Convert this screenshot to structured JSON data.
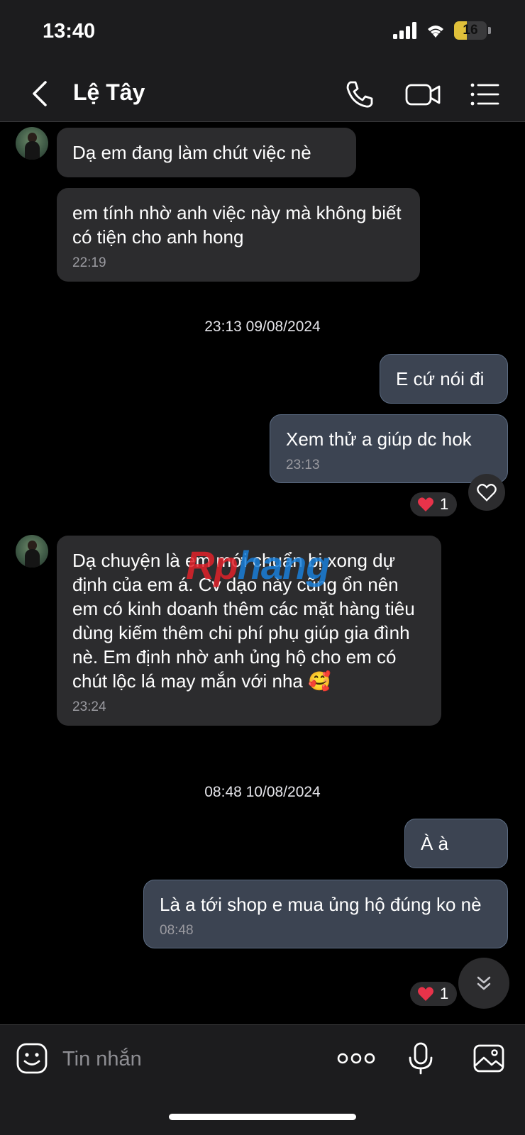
{
  "status_bar": {
    "time": "13:40",
    "battery": "16"
  },
  "header": {
    "contact_name": "Lệ Tây"
  },
  "messages": [
    {
      "text": "Dạ em đang làm chút việc nè"
    },
    {
      "text": "em tính nhờ anh việc này mà không biết có tiện cho anh hong",
      "time": "22:19"
    },
    {
      "text": "E cứ nói đi"
    },
    {
      "text": "Xem thử a giúp dc hok",
      "time": "23:13"
    },
    {
      "text": "Dạ chuyện là em mới chuẩn bị xong dự định của em á. Cv dạo này cũng ổn nên em có kinh doanh thêm các mặt hàng tiêu dùng kiếm thêm chi phí phụ giúp gia đình nè. Em định nhờ anh ủng hộ cho em có chút lộc lá may mắn với nha 🥰",
      "time": "23:24"
    },
    {
      "text": "À à"
    },
    {
      "text": "Là a tới shop e mua ủng hộ đúng ko nè",
      "time": "08:48"
    }
  ],
  "date_separators": [
    "23:13 09/08/2024",
    "08:48 10/08/2024"
  ],
  "reactions": [
    {
      "emoji": "❤️",
      "count": "1"
    },
    {
      "emoji": "❤️",
      "count": "1"
    }
  ],
  "watermark": {
    "part1": "Rp",
    "part2": "hang"
  },
  "input": {
    "placeholder": "Tin nhắn"
  },
  "colors": {
    "incoming_bubble": "#2c2c2e",
    "outgoing_bubble": "#3c4452",
    "reaction_heart": "#e8334a"
  }
}
